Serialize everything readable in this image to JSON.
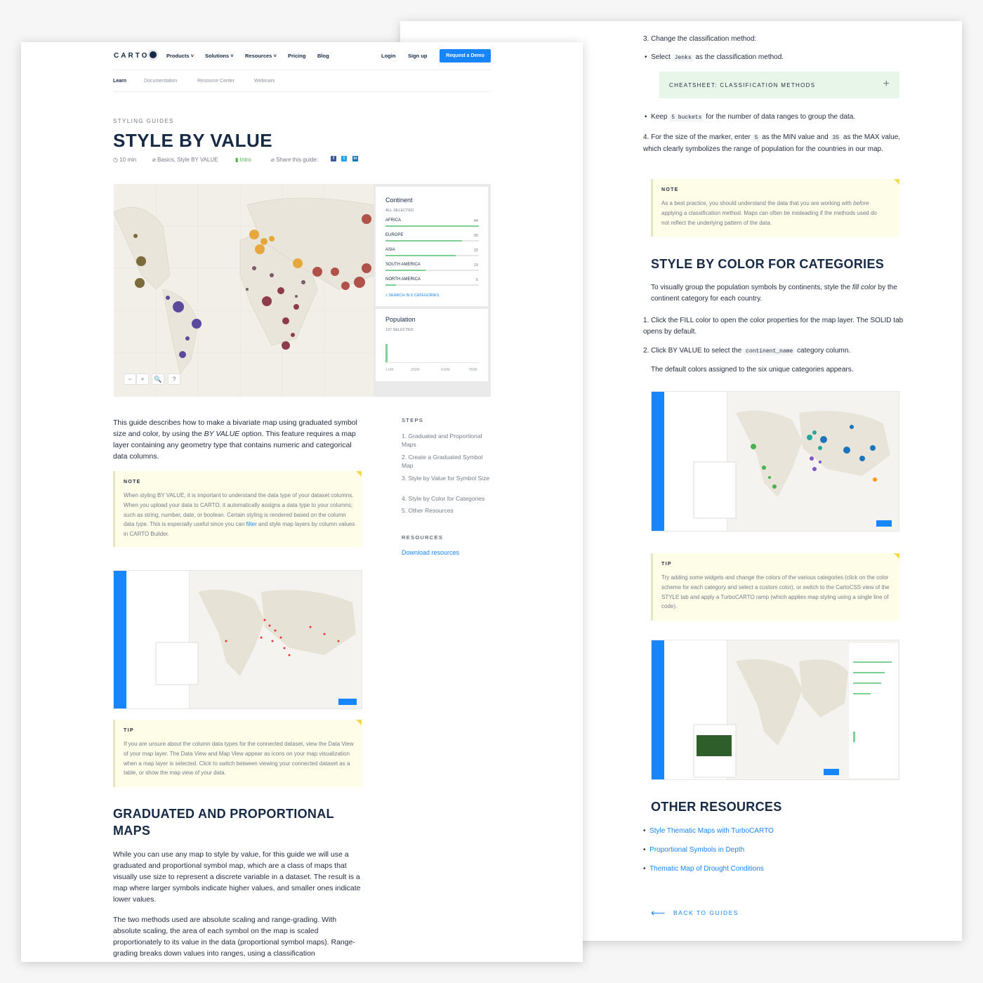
{
  "header": {
    "logo": "CARTO",
    "nav": [
      "Products",
      "Solutions",
      "Resources",
      "Pricing",
      "Blog"
    ],
    "login": "Login",
    "signup": "Sign up",
    "demo": "Request a Demo",
    "subnav": [
      "Learn",
      "Documentation",
      "Resource Center",
      "Webinars"
    ]
  },
  "guide": {
    "eyebrow": "STYLING GUIDES",
    "title": "STYLE BY VALUE",
    "duration": "10 min",
    "tags": "Basics, Style BY VALUE",
    "level": "Intro",
    "share": "Share this guide:"
  },
  "widgets": {
    "continent_title": "Continent",
    "all_selected": "ALL SELECTED",
    "categories": [
      {
        "label": "AFRICA",
        "value": "44",
        "fraction": 1.0
      },
      {
        "label": "EUROPE",
        "value": "36",
        "fraction": 0.82
      },
      {
        "label": "ASIA",
        "value": "33",
        "fraction": 0.75
      },
      {
        "label": "SOUTH AMERICA",
        "value": "19",
        "fraction": 0.43
      },
      {
        "label": "NORTH AMERICA",
        "value": "5",
        "fraction": 0.11
      }
    ],
    "search": "SEARCH IN 6 CATEGORIES",
    "population_title": "Population",
    "population_selected": "137 SELECTED",
    "axis": [
      "1.0M",
      "250M",
      "510M",
      "750M"
    ],
    "zoom": [
      "−",
      "+",
      "🔍",
      "?"
    ]
  },
  "intro": {
    "p1a": "This guide describes how to make a bivariate map using graduated symbol size and color, by using the ",
    "p1b": "BY VALUE",
    "p1c": " option. This feature requires a map layer containing any geometry type that contains numeric and categorical data columns."
  },
  "steps": {
    "title": "STEPS",
    "items": [
      "Graduated and Proportional Maps",
      "Create a Graduated Symbol Map",
      "Style by Value for Symbol Size",
      "Style by Color for Categories",
      "Other Resources"
    ],
    "resources_title": "RESOURCES",
    "download": "Download resources"
  },
  "note1": {
    "title": "NOTE",
    "body_a": "When styling BY VALUE, it is important to understand the data type of your dataset columns. When you upload your data to CARTO, it automatically assigns a data type to your columns; such as string, number, date, or boolean. Certain styling is rendered based on the column data type. This is especially useful since you can ",
    "body_link": "filter",
    "body_b": " and style map layers by column values in CARTO Builder."
  },
  "tip1": {
    "title": "TIP",
    "body": "If you are unsure about the column data types for the connected dataset, view the Data View of your map layer. The Data View and Map View appear as icons on your map visualization when a map layer is selected. Click to switch between viewing your connected dataset as a table, or show the map view of your data."
  },
  "section1": {
    "title_line1": "GRADUATED AND PROPORTIONAL",
    "title_line2": "MAPS",
    "p1": "While you can use any map to style by value, for this guide we will use a graduated and proportional symbol map, which are a class of maps that visually use size to represent a discrete variable in a dataset. The result is a map where larger symbols indicate higher values, and smaller ones indicate lower values.",
    "p2": "The two methods used are absolute scaling and range-grading. With absolute scaling, the area of each symbol on the map is scaled proportionately to its value in the data (proportional symbol maps). Range-grading breaks down values into ranges, using a classification"
  },
  "right": {
    "step3": "Change the classification method:",
    "bullet_jenks_a": "Select ",
    "bullet_jenks_code": "Jenks",
    "bullet_jenks_b": " as the classification method.",
    "cheatsheet": "CHEATSHEET: CLASSIFICATION METHODS",
    "bullet_keep_a": "Keep ",
    "bullet_keep_code": "5 buckets",
    "bullet_keep_b": " for the number of data ranges to group the data.",
    "step4_a": "For the size of the marker, enter ",
    "step4_min": "5",
    "step4_b": " as the MIN value and ",
    "step4_max": "35",
    "step4_c": " as the MAX value, which clearly symbolizes the range of population for the countries in our map.",
    "note_title": "NOTE",
    "note_a": "As a best practice, you should understand the data that you are working with ",
    "note_em": "before",
    "note_b": " applying a classification method. Maps can often be misleading if the methods used do not reflect the underlying pattern of the data.",
    "section_title": "STYLE BY COLOR FOR CATEGORIES",
    "intro_a": "To visually group the population symbols by continents, style the ",
    "intro_em": "fill color",
    "intro_b": " by the continent category for each country.",
    "s1": "Click the FILL color to open the color properties for the map layer. The SOLID tab opens by default.",
    "s2_a": "Click BY VALUE to select the ",
    "s2_code": "continent_name",
    "s2_b": " category column.",
    "default_colors": "The default colors assigned to the six unique categories appears.",
    "tip_title": "TIP",
    "tip_body": "Try adding some widgets and change the colors of the various categories (click on the color scheme for each category and select a custom color), or switch to the CartoCSS view of the STYLE tab and apply a TurboCARTO ramp (which applies map styling using a single line of code).",
    "other_title": "OTHER RESOURCES",
    "links": [
      "Style Thematic Maps with TurboCARTO",
      "Proportional Symbols in Depth",
      "Thematic Map of Drought Conditions"
    ],
    "back": "BACK TO GUIDES"
  },
  "colors": {
    "accent": "#1785fb",
    "navy": "#162945",
    "callout_bg": "#fdfde8",
    "cheat_bg": "#e8f6ea"
  }
}
